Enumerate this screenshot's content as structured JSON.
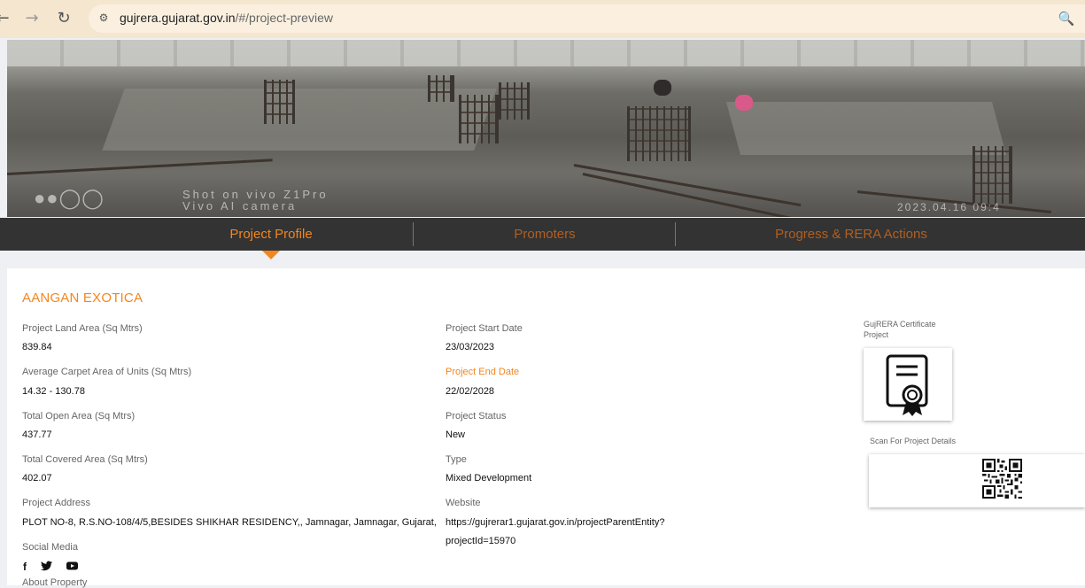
{
  "browser": {
    "url_host": "gujrera.gujarat.gov.in",
    "url_path": "/#/project-preview",
    "back_icon": "back-arrow-icon",
    "forward_icon": "forward-arrow-icon",
    "reload_icon": "reload-icon",
    "site_info_icon": "site-info-icon",
    "zoom_icon": "zoom-icon"
  },
  "banner": {
    "watermark_line1": "Shot on vivo Z1Pro",
    "watermark_line2": "Vivo AI camera",
    "timestamp": "2023.04.16 09:4"
  },
  "tabs": [
    {
      "label": "Project Profile",
      "active": true
    },
    {
      "label": "Promoters",
      "active": false
    },
    {
      "label": "Progress & RERA Actions",
      "active": false
    }
  ],
  "project": {
    "name": "AANGAN EXOTICA",
    "left_fields": [
      {
        "label": "Project Land Area (Sq Mtrs)",
        "value": "839.84"
      },
      {
        "label": "Average Carpet Area of Units (Sq Mtrs)",
        "value": "14.32 - 130.78"
      },
      {
        "label": "Total Open Area (Sq Mtrs)",
        "value": "437.77"
      },
      {
        "label": "Total Covered Area (Sq Mtrs)",
        "value": "402.07"
      },
      {
        "label": "Project Address",
        "value": "PLOT NO-8, R.S.NO-108/4/5,BESIDES SHIKHAR RESIDENCY,, Jamnagar, Jamnagar, Gujarat,"
      }
    ],
    "right_fields": [
      {
        "label": "Project Start Date",
        "value": "23/03/2023"
      },
      {
        "label": "Project End Date",
        "value": "22/02/2028"
      },
      {
        "label": "Project Status",
        "value": "New"
      },
      {
        "label": "Type",
        "value": "Mixed Development"
      },
      {
        "label": "Website",
        "value_line1": "https://gujrerar1.gujarat.gov.in/projectParentEntity?",
        "value_line2": "projectId=15970"
      }
    ],
    "social_label": "Social Media",
    "social_icons": [
      "facebook-icon",
      "twitter-icon",
      "youtube-icon"
    ],
    "about_label": "About Property"
  },
  "sidebar": {
    "cert_label_line1": "GujRERA Certificate",
    "cert_label_line2": "Project",
    "cert_icon": "certificate-icon",
    "scan_label": "Scan For Project Details",
    "qr_icon": "qr-code-icon"
  },
  "colors": {
    "accent": "#f2861e",
    "tab_inactive": "#b25f1f",
    "tabbar_bg": "#333333",
    "browser_bar": "#f5e6cf"
  }
}
